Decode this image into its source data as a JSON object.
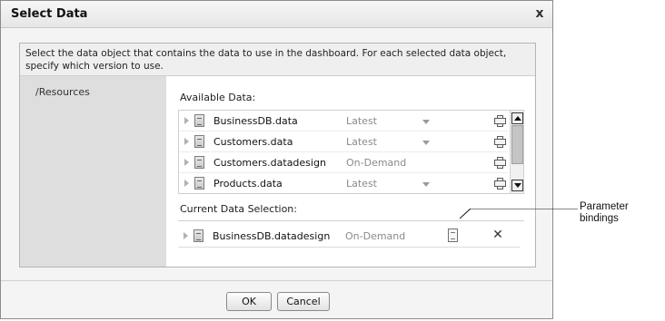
{
  "dialog": {
    "title": "Select Data",
    "close_label": "x",
    "instructions": "Select the data object that contains the data to use in the dashboard. For each selected data object, specify which version to use.",
    "folder": "/Resources"
  },
  "available": {
    "label": "Available Data:",
    "rows": [
      {
        "name": "BusinessDB.data",
        "version": "Latest",
        "has_dropdown": true
      },
      {
        "name": "Customers.data",
        "version": "Latest",
        "has_dropdown": true
      },
      {
        "name": "Customers.datadesign",
        "version": "On-Demand",
        "has_dropdown": false
      },
      {
        "name": "Products.data",
        "version": "Latest",
        "has_dropdown": true
      }
    ]
  },
  "current": {
    "label": "Current Data Selection:",
    "rows": [
      {
        "name": "BusinessDB.datadesign",
        "version": "On-Demand"
      }
    ]
  },
  "buttons": {
    "ok": "OK",
    "cancel": "Cancel"
  },
  "callout": {
    "line1": "Parameter",
    "line2": "bindings"
  },
  "icons": {
    "close": "close-icon",
    "expander": "expand-arrow-icon",
    "file": "data-file-icon",
    "add": "add-plus-icon",
    "parameter_bindings": "parameter-bindings-icon",
    "remove": "remove-x-icon"
  }
}
